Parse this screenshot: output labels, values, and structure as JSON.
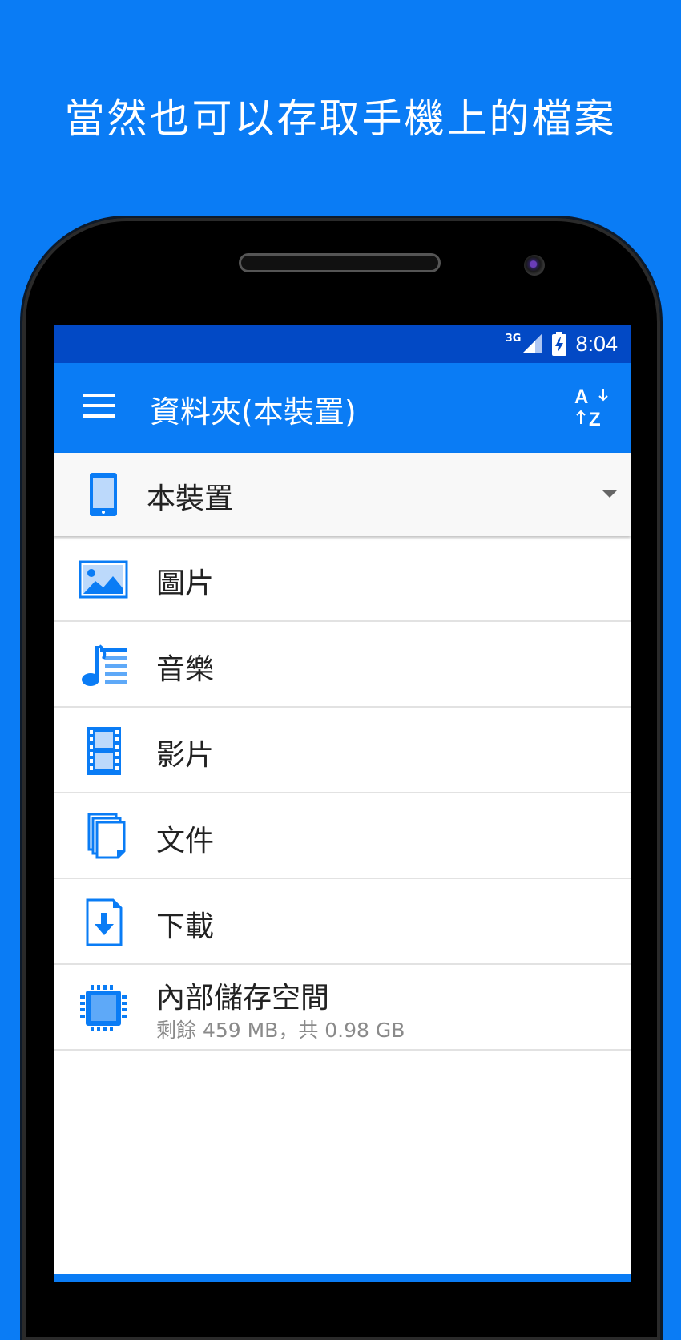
{
  "headline": "當然也可以存取手機上的檔案",
  "status_bar": {
    "network": "3G",
    "time": "8:04"
  },
  "app_bar": {
    "title": "資料夾(本裝置)"
  },
  "device_selector": {
    "label": "本裝置"
  },
  "folders": [
    {
      "label": "圖片",
      "icon": "image-icon"
    },
    {
      "label": "音樂",
      "icon": "music-icon"
    },
    {
      "label": "影片",
      "icon": "film-icon"
    },
    {
      "label": "文件",
      "icon": "documents-icon"
    },
    {
      "label": "下載",
      "icon": "download-icon"
    },
    {
      "label": "內部儲存空間",
      "sublabel": "剩餘 459 MB，共 0.98 GB",
      "icon": "chip-icon"
    }
  ],
  "colors": {
    "accent": "#0a7cf5",
    "status_bar": "#0249c5"
  }
}
